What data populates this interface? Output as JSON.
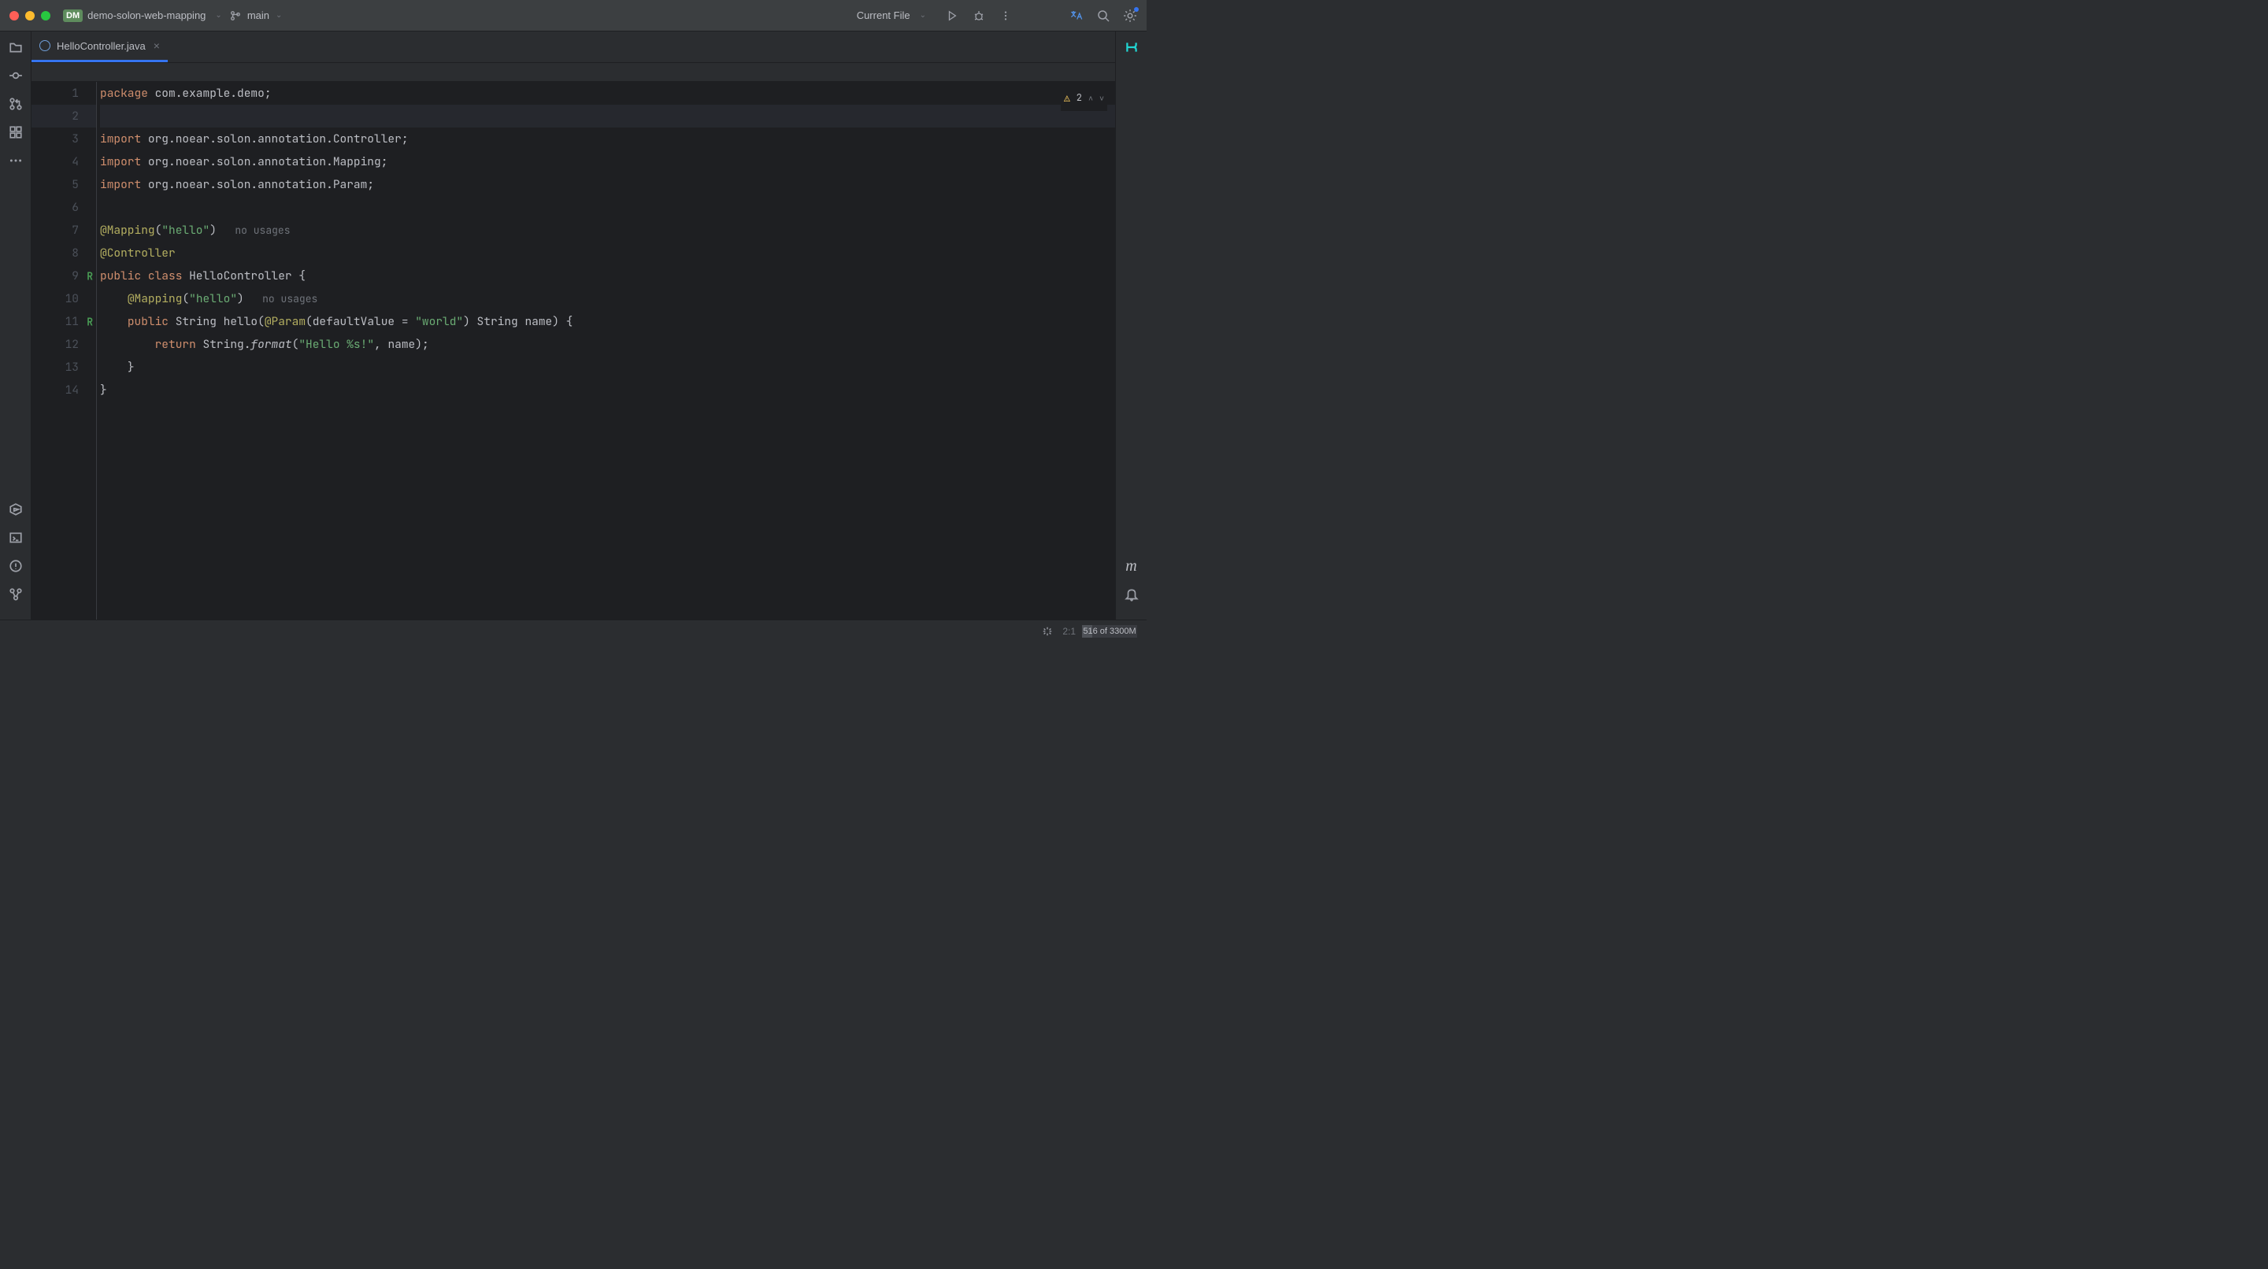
{
  "titlebar": {
    "project_badge": "DM",
    "project_name": "demo-solon-web-mapping",
    "branch_name": "main",
    "run_config": "Current File"
  },
  "tab": {
    "file_name": "HelloController.java"
  },
  "gutter": {
    "lines": [
      "1",
      "2",
      "3",
      "4",
      "5",
      "6",
      "7",
      "8",
      "9",
      "10",
      "11",
      "12",
      "13",
      "14"
    ]
  },
  "code": {
    "l1": {
      "kw": "package ",
      "pkg": "com.example.demo",
      "sc": ";"
    },
    "l3": {
      "kw": "import ",
      "pkg": "org.noear.solon.annotation.",
      "cls": "Controller",
      "sc": ";"
    },
    "l4": {
      "kw": "import ",
      "pkg": "org.noear.solon.annotation.",
      "cls": "Mapping",
      "sc": ";"
    },
    "l5": {
      "kw": "import ",
      "pkg": "org.noear.solon.annotation.",
      "cls": "Param",
      "sc": ";"
    },
    "l7": {
      "ann": "@Mapping",
      "lp": "(",
      "str": "\"hello\"",
      "rp": ")",
      "hint": "   no usages"
    },
    "l8": {
      "ann": "@Controller"
    },
    "l9": {
      "kw1": "public ",
      "kw2": "class ",
      "cls": "HelloController",
      "br": " {"
    },
    "l10": {
      "indent": "    ",
      "ann": "@Mapping",
      "lp": "(",
      "str": "\"hello\"",
      "rp": ")",
      "hint": "   no usages"
    },
    "l11": {
      "indent": "    ",
      "kw": "public ",
      "type": "String ",
      "name": "hello",
      "lp": "(",
      "ann": "@Param",
      "lp2": "(",
      "attr": "defaultValue = ",
      "str": "\"world\"",
      "rp2": ") ",
      "type2": "String ",
      "param": "name",
      "rp": ") {"
    },
    "l12": {
      "indent": "        ",
      "kw": "return ",
      "cls": "String.",
      "method": "format",
      "lp": "(",
      "str": "\"Hello %s!\"",
      "comma": ", ",
      "param": "name",
      "rp": ");"
    },
    "l13": {
      "indent": "    ",
      "br": "}"
    },
    "l14": {
      "br": "}"
    }
  },
  "inspection": {
    "count": "2"
  },
  "statusbar": {
    "cursor": "2:1",
    "memory": "516 of 3300M"
  }
}
